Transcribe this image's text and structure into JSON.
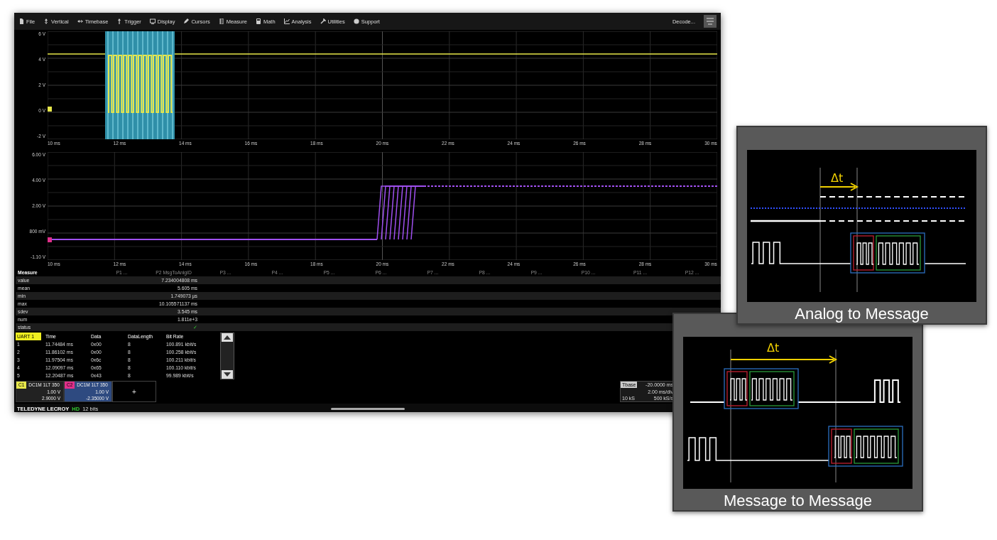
{
  "menu": [
    {
      "label": "File"
    },
    {
      "label": "Vertical"
    },
    {
      "label": "Timebase"
    },
    {
      "label": "Trigger"
    },
    {
      "label": "Display"
    },
    {
      "label": "Cursors"
    },
    {
      "label": "Measure"
    },
    {
      "label": "Math"
    },
    {
      "label": "Analysis"
    },
    {
      "label": "Utilities"
    },
    {
      "label": "Support"
    }
  ],
  "decode_button": {
    "label": "Decode..."
  },
  "plots": [
    {
      "kind": "digital",
      "color": "#e6e64a",
      "y_labels": [
        "6 V",
        "4 V",
        "2 V",
        "0 V",
        "-2 V"
      ],
      "x_labels": [
        "10 ms",
        "12 ms",
        "14 ms",
        "16 ms",
        "18 ms",
        "20 ms",
        "22 ms",
        "24 ms",
        "26 ms",
        "28 ms",
        "30 ms"
      ]
    },
    {
      "kind": "analog",
      "color": "#a050f0",
      "y_labels": [
        "6.00 V",
        "4.00 V",
        "2.00 V",
        "800 mV",
        "-1.10 V"
      ],
      "x_labels": [
        "10 ms",
        "12 ms",
        "14 ms",
        "16 ms",
        "18 ms",
        "20 ms",
        "22 ms",
        "24 ms",
        "26 ms",
        "28 ms",
        "30 ms"
      ]
    }
  ],
  "measure": {
    "title": "Measure",
    "params": [
      "P1 ...",
      "P2 MsgToAnlgID",
      "P3 ...",
      "P4 ...",
      "P5 ...",
      "P6 ...",
      "P7 ...",
      "P8 ...",
      "P9 ...",
      "P10 ...",
      "P11 ...",
      "P12 ..."
    ],
    "rows": [
      {
        "label": "value",
        "value": "7.234004808 ms",
        "kind": "number"
      },
      {
        "label": "mean",
        "value": "5.605 ms",
        "kind": "number"
      },
      {
        "label": "min",
        "value": "1.749073 µs",
        "kind": "number"
      },
      {
        "label": "max",
        "value": "10.105571137 ms",
        "kind": "number"
      },
      {
        "label": "sdev",
        "value": "3.545 ms",
        "kind": "number"
      },
      {
        "label": "num",
        "value": "1.811e+3",
        "kind": "number"
      },
      {
        "label": "status",
        "value": "✓",
        "kind": "status"
      }
    ]
  },
  "decode": {
    "columns": [
      "UART 1",
      "Time",
      "Data",
      "DataLength",
      "Bit Rate"
    ],
    "rows": [
      [
        "1",
        "11.74484 ms",
        "0x00",
        "8",
        "100.891 kbit/s"
      ],
      [
        "2",
        "11.86102 ms",
        "0x00",
        "8",
        "100.258 kbit/s"
      ],
      [
        "3",
        "11.97504 ms",
        "0x6c",
        "8",
        "100.211 kbit/s"
      ],
      [
        "4",
        "12.09097 ms",
        "0x65",
        "8",
        "100.110 kbit/s"
      ],
      [
        "5",
        "12.20487 ms",
        "0x43",
        "8",
        "99.989 kbit/s"
      ]
    ]
  },
  "channels": [
    {
      "tag": "C1",
      "color": "#e6e64a",
      "descriptor": "DC1M 1LT 350",
      "scale": "1.00 V",
      "offset": "2.9000 V"
    },
    {
      "tag": "C2",
      "color": "#e0308a",
      "descriptor": "DC1M 1LT 350",
      "scale": "1.00 V",
      "offset": "-2.35000 V"
    }
  ],
  "add_label": "+",
  "timebase": {
    "label": "Tbase",
    "delay": "-20.0000 ms",
    "scale": "2.00 ms/div",
    "samples": "10 kS",
    "rate": "500 kS/s"
  },
  "footer": {
    "brand": "TELEDYNE LECROY",
    "mode": "HD",
    "bits": "12 bits"
  },
  "insets": [
    {
      "kind": "analog",
      "delta_label": "Δt",
      "caption": "Analog to Message"
    },
    {
      "kind": "message",
      "delta_label": "Δt",
      "caption": "Message to Message"
    }
  ]
}
